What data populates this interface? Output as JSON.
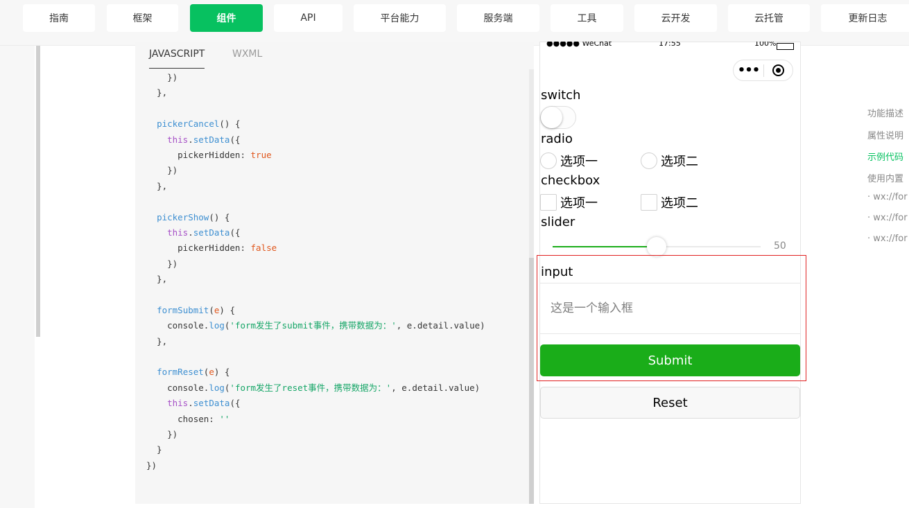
{
  "nav": {
    "items": [
      {
        "label": "指南",
        "active": false
      },
      {
        "label": "框架",
        "active": false
      },
      {
        "label": "组件",
        "active": true
      },
      {
        "label": "API",
        "active": false
      },
      {
        "label": "平台能力",
        "active": false
      },
      {
        "label": "服务端",
        "active": false
      },
      {
        "label": "工具",
        "active": false
      },
      {
        "label": "云开发",
        "active": false
      },
      {
        "label": "云托管",
        "active": false
      },
      {
        "label": "更新日志",
        "active": false
      }
    ]
  },
  "code_tabs": {
    "javascript": "JAVASCRIPT",
    "wxml": "WXML"
  },
  "code": {
    "lines": [
      "    })",
      "  },",
      "",
      "  pickerCancel() {",
      "    this.setData({",
      "      pickerHidden: true",
      "    })",
      "  },",
      "",
      "  pickerShow() {",
      "    this.setData({",
      "      pickerHidden: false",
      "    })",
      "  },",
      "",
      "  formSubmit(e) {",
      "    console.log('form发生了submit事件，携带数据为：', e.detail.value)",
      "  },",
      "",
      "  formReset(e) {",
      "    console.log('form发生了reset事件，携带数据为：', e.detail.value)",
      "    this.setData({",
      "      chosen: ''",
      "    })",
      "  }",
      "})"
    ]
  },
  "phone": {
    "status": {
      "carrier": "●●●●● WeChat",
      "time": "17:55",
      "battery": "100%"
    },
    "switch_label": "switch",
    "switch_on": false,
    "radio_label": "radio",
    "radio_options": [
      "选项一",
      "选项二"
    ],
    "checkbox_label": "checkbox",
    "checkbox_options": [
      "选项一",
      "选项二"
    ],
    "slider_label": "slider",
    "slider_value": "50",
    "slider_fraction": 0.5,
    "input_label": "input",
    "input_placeholder": "这是一个输入框",
    "submit_label": "Submit",
    "reset_label": "Reset"
  },
  "toc": {
    "items": [
      {
        "label": "功能描述",
        "active": false
      },
      {
        "label": "属性说明",
        "active": false
      },
      {
        "label": "示例代码",
        "active": true
      },
      {
        "label": "使用内置",
        "active": false
      },
      {
        "label": "· wx://for",
        "active": false
      },
      {
        "label": "· wx://for",
        "active": false
      },
      {
        "label": "· wx://for",
        "active": false
      }
    ]
  },
  "colors": {
    "accent": "#07c160",
    "submit": "#1aad19",
    "highlight_frame": "#e02020"
  }
}
